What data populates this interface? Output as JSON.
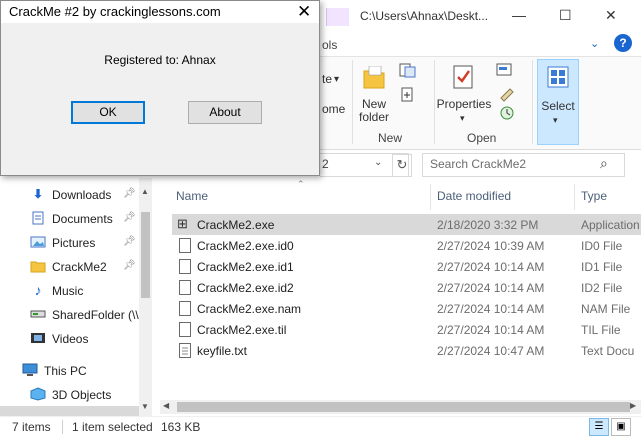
{
  "dialog": {
    "title": "CrackMe #2  by crackinglessons.com",
    "close_glyph": "✕",
    "message": "Registered to: Ahnax",
    "ok_label": "OK",
    "about_label": "About"
  },
  "explorer": {
    "window_title": "C:\\Users\\Ahnax\\Deskt...",
    "min_glyph": "—",
    "max_glyph": "☐",
    "close_glyph": "✕",
    "partial_tab": "ols",
    "ribbon_chevron": "⌄",
    "help_glyph": "?",
    "ribbon": {
      "partial_left_label": "te",
      "partial_left_label2": "ome",
      "new_folder_label": "New folder",
      "new_group": "New",
      "properties_label": "Properties",
      "open_group": "Open",
      "select_label": "Select"
    },
    "address": {
      "partial_text": "2",
      "refresh_glyph": "↻"
    },
    "search": {
      "placeholder": "Search CrackMe2"
    },
    "nav_items": [
      {
        "label": "Downloads",
        "icon": "download-icon",
        "pinned": true
      },
      {
        "label": "Documents",
        "icon": "documents-icon",
        "pinned": true
      },
      {
        "label": "Pictures",
        "icon": "pictures-icon",
        "pinned": true
      },
      {
        "label": "CrackMe2",
        "icon": "folder-icon",
        "pinned": true
      },
      {
        "label": "Music",
        "icon": "music-icon",
        "pinned": false
      },
      {
        "label": "SharedFolder (\\\\",
        "icon": "network-drive-icon",
        "pinned": false
      },
      {
        "label": "Videos",
        "icon": "videos-icon",
        "pinned": false
      },
      {
        "label": "This PC",
        "icon": "computer-icon",
        "pinned": false
      },
      {
        "label": "3D Objects",
        "icon": "cube-icon",
        "pinned": false
      }
    ],
    "columns": {
      "name": "Name",
      "date": "Date modified",
      "type": "Type"
    },
    "files": [
      {
        "name": "CrackMe2.exe",
        "date": "2/18/2020 3:32 PM",
        "type": "Application",
        "icon": "application-icon",
        "selected": true
      },
      {
        "name": "CrackMe2.exe.id0",
        "date": "2/27/2024 10:39 AM",
        "type": "ID0 File",
        "icon": "file-icon",
        "selected": false
      },
      {
        "name": "CrackMe2.exe.id1",
        "date": "2/27/2024 10:14 AM",
        "type": "ID1 File",
        "icon": "file-icon",
        "selected": false
      },
      {
        "name": "CrackMe2.exe.id2",
        "date": "2/27/2024 10:14 AM",
        "type": "ID2 File",
        "icon": "file-icon",
        "selected": false
      },
      {
        "name": "CrackMe2.exe.nam",
        "date": "2/27/2024 10:14 AM",
        "type": "NAM File",
        "icon": "file-icon",
        "selected": false
      },
      {
        "name": "CrackMe2.exe.til",
        "date": "2/27/2024 10:14 AM",
        "type": "TIL File",
        "icon": "file-icon",
        "selected": false
      },
      {
        "name": "keyfile.txt",
        "date": "2/27/2024 10:47 AM",
        "type": "Text Docu",
        "icon": "text-file-icon",
        "selected": false
      }
    ],
    "status": {
      "item_count": "7 items",
      "selection": "1 item selected",
      "size": "163 KB"
    },
    "colors": {
      "selection": "#d9d9d9",
      "accent": "#0078d7",
      "select_highlight": "#cce8ff"
    }
  }
}
